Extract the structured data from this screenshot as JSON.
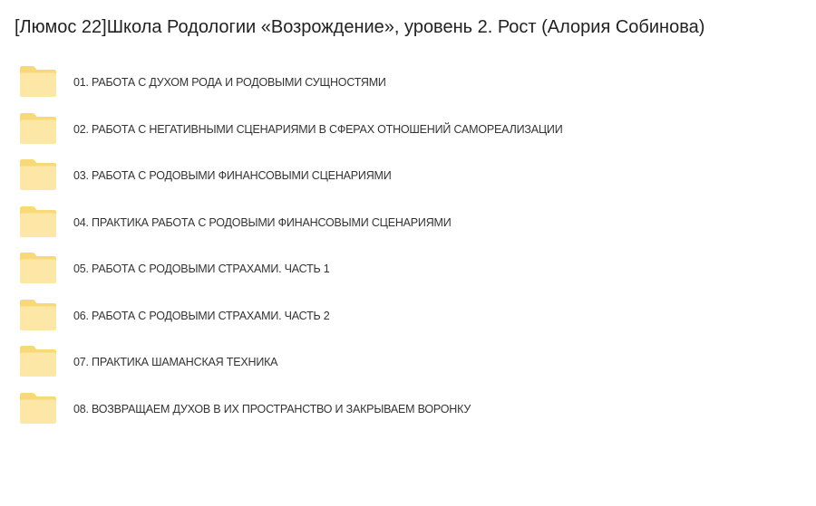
{
  "folder": {
    "title": "[Люмос 22]Школа Родологии «Возрождение», уровень 2. Рост (Алория Собинова)"
  },
  "colors": {
    "folder_front": "#FCE7A7",
    "folder_back": "#F7D977",
    "text": "#333333"
  },
  "items": [
    {
      "name": "01. РАБОТА С ДУХОМ РОДА И РОДОВЫМИ СУЩНОСТЯМИ",
      "icon": "folder-icon"
    },
    {
      "name": "02. РАБОТА С НЕГАТИВНЫМИ СЦЕНАРИЯМИ В СФЕРАХ ОТНОШЕНИЙ САМОРЕАЛИЗАЦИИ",
      "icon": "folder-icon"
    },
    {
      "name": "03. РАБОТА С РОДОВЫМИ ФИНАНСОВЫМИ СЦЕНАРИЯМИ",
      "icon": "folder-icon"
    },
    {
      "name": "04. ПРАКТИКА РАБОТА С РОДОВЫМИ ФИНАНСОВЫМИ СЦЕНАРИЯМИ",
      "icon": "folder-icon"
    },
    {
      "name": "05. РАБОТА С РОДОВЫМИ СТРАХАМИ. ЧАСТЬ 1",
      "icon": "folder-icon"
    },
    {
      "name": "06. РАБОТА С РОДОВЫМИ СТРАХАМИ. ЧАСТЬ 2",
      "icon": "folder-icon"
    },
    {
      "name": "07. ПРАКТИКА ШАМАНСКАЯ ТЕХНИКА",
      "icon": "folder-icon"
    },
    {
      "name": "08. ВОЗВРАЩАЕМ ДУХОВ В ИХ ПРОСТРАНСТВО И ЗАКРЫВАЕМ ВОРОНКУ",
      "icon": "folder-icon"
    }
  ]
}
